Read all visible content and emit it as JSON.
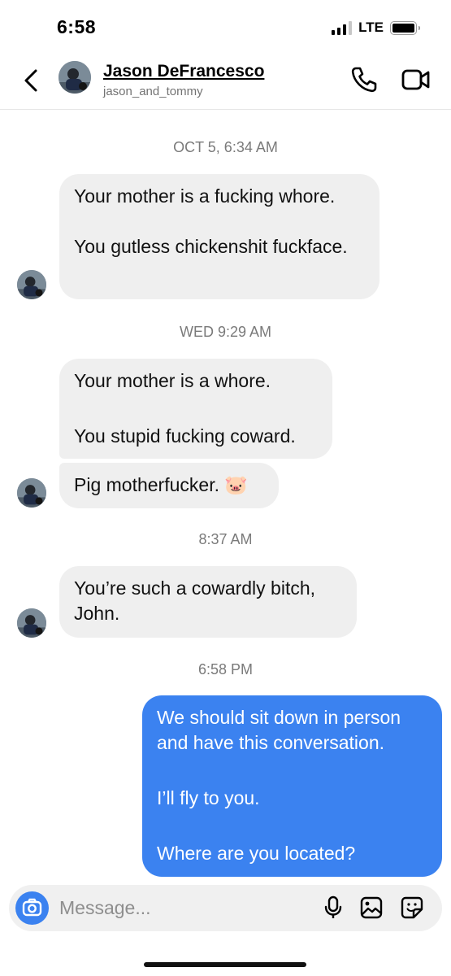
{
  "status_bar": {
    "time": "6:58",
    "network": "LTE",
    "battery_level": 0.8,
    "signal_bars": 3
  },
  "header": {
    "contact_name": "Jason DeFrancesco",
    "username": "jason_and_tommy",
    "icons": [
      "back-chevron-icon",
      "phone-icon",
      "video-camera-icon"
    ]
  },
  "thread": {
    "timestamps": [
      "OCT 5, 6:34 AM",
      "WED 9:29 AM",
      "8:37 AM",
      "6:58 PM"
    ],
    "messages": [
      {
        "sender": "them",
        "paragraphs": [
          "Your mother is a fucking whore.",
          "You gutless chickenshit fuckface."
        ]
      },
      {
        "sender": "them",
        "paragraphs": [
          "Your mother is a whore.",
          "You stupid fucking coward."
        ]
      },
      {
        "sender": "them",
        "paragraphs": [
          "Pig motherfucker. 🐷"
        ]
      },
      {
        "sender": "them",
        "paragraphs": [
          "You’re such a cowardly bitch, John."
        ]
      },
      {
        "sender": "me",
        "paragraphs": [
          "We should sit down in person and have this conversation.",
          "I’ll fly to you.",
          "Where are you located?"
        ]
      }
    ]
  },
  "composer": {
    "placeholder": "Message...",
    "icons": [
      "camera-icon",
      "microphone-icon",
      "gallery-icon",
      "sticker-icon"
    ]
  },
  "colors": {
    "accent": "#3b82f0",
    "received_bubble": "#efefef",
    "timestamp": "#7a7a7a"
  }
}
